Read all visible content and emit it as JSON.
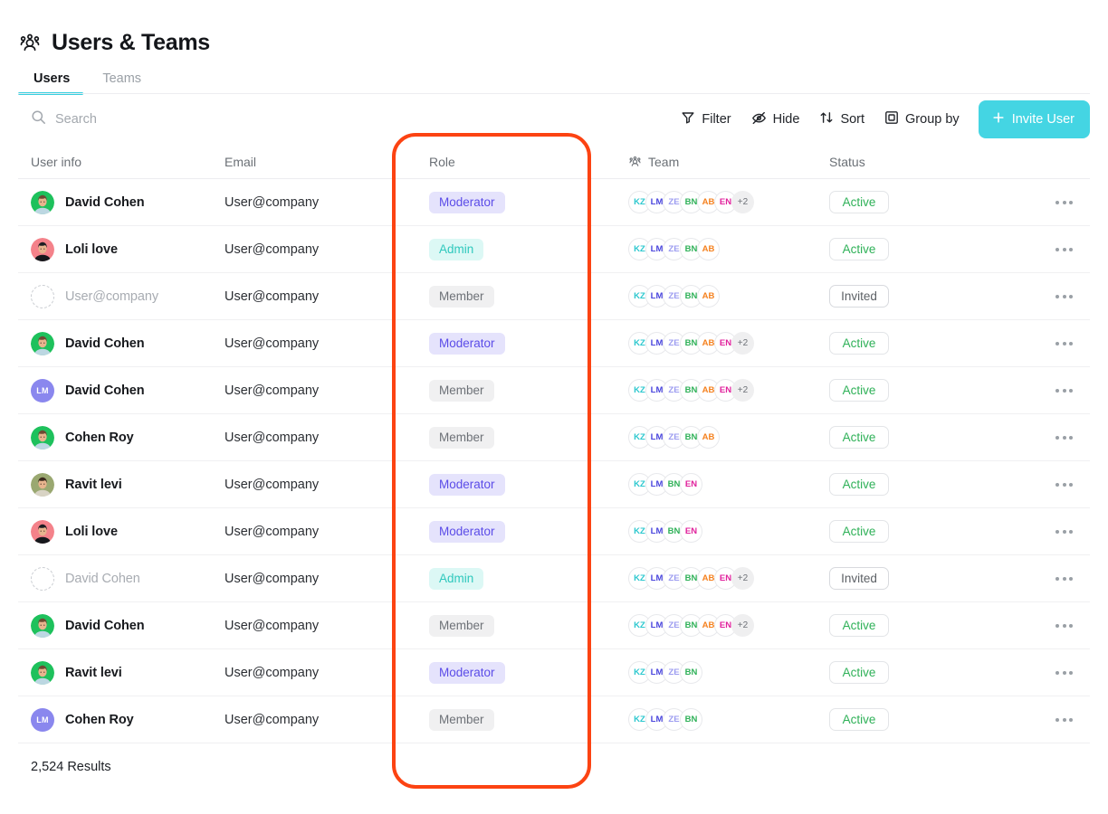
{
  "header": {
    "title": "Users & Teams",
    "title_icon": "users-group-icon"
  },
  "tabs": [
    {
      "label": "Users",
      "active": true
    },
    {
      "label": "Teams",
      "active": false
    }
  ],
  "toolbar": {
    "search": {
      "placeholder": "Search",
      "value": "",
      "icon": "search-icon"
    },
    "actions": [
      {
        "label": "Filter",
        "icon": "filter-icon"
      },
      {
        "label": "Hide",
        "icon": "eye-off-icon"
      },
      {
        "label": "Sort",
        "icon": "sort-arrows-icon"
      },
      {
        "label": "Group by",
        "icon": "group-by-icon"
      }
    ],
    "invite": {
      "label": "Invite User",
      "icon": "plus-icon",
      "color": "#44d5e3"
    }
  },
  "table": {
    "columns": [
      {
        "key": "user",
        "label": "User info"
      },
      {
        "key": "email",
        "label": "Email"
      },
      {
        "key": "role",
        "label": "Role"
      },
      {
        "key": "team",
        "label": "Team",
        "icon": "users-group-icon"
      },
      {
        "key": "status",
        "label": "Status"
      }
    ],
    "rows": [
      {
        "name": "David Cohen",
        "avatar": "photo-green",
        "muted": false,
        "email": "User@company",
        "role": "Moderator",
        "role_kind": "moderator",
        "team": [
          "KZ",
          "LM",
          "ZE",
          "BN",
          "AB",
          "EN"
        ],
        "team_more": "+2",
        "status": "Active",
        "status_kind": "active"
      },
      {
        "name": "Loli love",
        "avatar": "photo-pink",
        "muted": false,
        "email": "User@company",
        "role": "Admin",
        "role_kind": "admin",
        "team": [
          "KZ",
          "LM",
          "ZE",
          "BN",
          "AB"
        ],
        "team_more": "",
        "status": "Active",
        "status_kind": "active"
      },
      {
        "name": "User@company",
        "avatar": "placeholder",
        "muted": true,
        "email": "User@company",
        "role": "Member",
        "role_kind": "member",
        "team": [
          "KZ",
          "LM",
          "ZE",
          "BN",
          "AB"
        ],
        "team_more": "",
        "status": "Invited",
        "status_kind": "invited"
      },
      {
        "name": "David Cohen",
        "avatar": "photo-green",
        "muted": false,
        "email": "User@company",
        "role": "Moderator",
        "role_kind": "moderator",
        "team": [
          "KZ",
          "LM",
          "ZE",
          "BN",
          "AB",
          "EN"
        ],
        "team_more": "+2",
        "status": "Active",
        "status_kind": "active"
      },
      {
        "name": "David Cohen",
        "avatar": "initials-lm",
        "muted": false,
        "email": "User@company",
        "role": "Member",
        "role_kind": "member",
        "team": [
          "KZ",
          "LM",
          "ZE",
          "BN",
          "AB",
          "EN"
        ],
        "team_more": "+2",
        "status": "Active",
        "status_kind": "active"
      },
      {
        "name": "Cohen Roy",
        "avatar": "photo-green",
        "muted": false,
        "email": "User@company",
        "role": "Member",
        "role_kind": "member",
        "team": [
          "KZ",
          "LM",
          "ZE",
          "BN",
          "AB"
        ],
        "team_more": "",
        "status": "Active",
        "status_kind": "active"
      },
      {
        "name": "Ravit levi",
        "avatar": "photo-woman",
        "muted": false,
        "email": "User@company",
        "role": "Moderator",
        "role_kind": "moderator",
        "team": [
          "KZ",
          "LM",
          "BN",
          "EN"
        ],
        "team_more": "",
        "status": "Active",
        "status_kind": "active"
      },
      {
        "name": "Loli love",
        "avatar": "photo-pink",
        "muted": false,
        "email": "User@company",
        "role": "Moderator",
        "role_kind": "moderator",
        "team": [
          "KZ",
          "LM",
          "BN",
          "EN"
        ],
        "team_more": "",
        "status": "Active",
        "status_kind": "active"
      },
      {
        "name": "David Cohen",
        "avatar": "placeholder",
        "muted": true,
        "email": "User@company",
        "role": "Admin",
        "role_kind": "admin",
        "team": [
          "KZ",
          "LM",
          "ZE",
          "BN",
          "AB",
          "EN"
        ],
        "team_more": "+2",
        "status": "Invited",
        "status_kind": "invited"
      },
      {
        "name": "David Cohen",
        "avatar": "photo-green",
        "muted": false,
        "email": "User@company",
        "role": "Member",
        "role_kind": "member",
        "team": [
          "KZ",
          "LM",
          "ZE",
          "BN",
          "AB",
          "EN"
        ],
        "team_more": "+2",
        "status": "Active",
        "status_kind": "active"
      },
      {
        "name": "Ravit levi",
        "avatar": "photo-green",
        "muted": false,
        "email": "User@company",
        "role": "Moderator",
        "role_kind": "moderator",
        "team": [
          "KZ",
          "LM",
          "ZE",
          "BN"
        ],
        "team_more": "",
        "status": "Active",
        "status_kind": "active"
      },
      {
        "name": "Cohen Roy",
        "avatar": "initials-lm",
        "muted": false,
        "email": "User@company",
        "role": "Member",
        "role_kind": "member",
        "team": [
          "KZ",
          "LM",
          "ZE",
          "BN"
        ],
        "team_more": "",
        "status": "Active",
        "status_kind": "active"
      }
    ],
    "row_menu_icon": "more-horizontal-icon"
  },
  "footer": {
    "results": "2,524 Results"
  },
  "team_initial_colors": {
    "KZ": "#2ec8cf",
    "LM": "#4a46dd",
    "ZE": "#9c9cf0",
    "BN": "#2fb158",
    "AB": "#f58220",
    "EN": "#e0219c"
  },
  "annotation": {
    "shape": "rounded-rect",
    "color": "#fc4312",
    "target": "role-column"
  }
}
